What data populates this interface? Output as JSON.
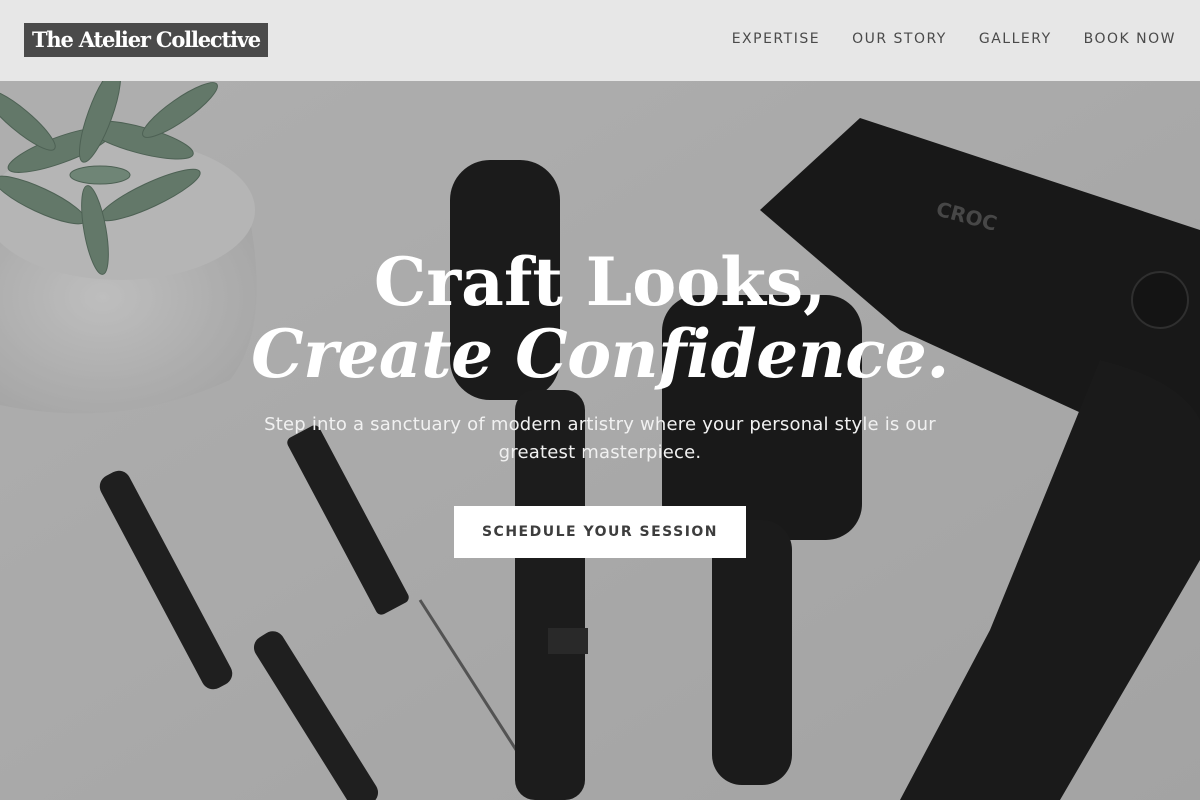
{
  "brand": {
    "name": "The Atelier Collective"
  },
  "nav": {
    "items": [
      {
        "label": "EXPERTISE"
      },
      {
        "label": "OUR STORY"
      },
      {
        "label": "GALLERY"
      },
      {
        "label": "BOOK NOW"
      }
    ]
  },
  "hero": {
    "headline_line1": "Craft Looks,",
    "headline_line2": "Create Confidence.",
    "subtitle": "Step into a sanctuary of modern artistry where your personal style is our greatest masterpiece.",
    "cta_label": "SCHEDULE YOUR SESSION",
    "background_image": "hair-styling-tools-flatlay",
    "product_brand_mark": "CROC"
  },
  "colors": {
    "header_bg": "#e7e7e7",
    "logo_bg": "#4a4a4a",
    "nav_text": "#4a4a4a",
    "cta_bg": "#ffffff",
    "cta_text": "#3d3d3d"
  }
}
